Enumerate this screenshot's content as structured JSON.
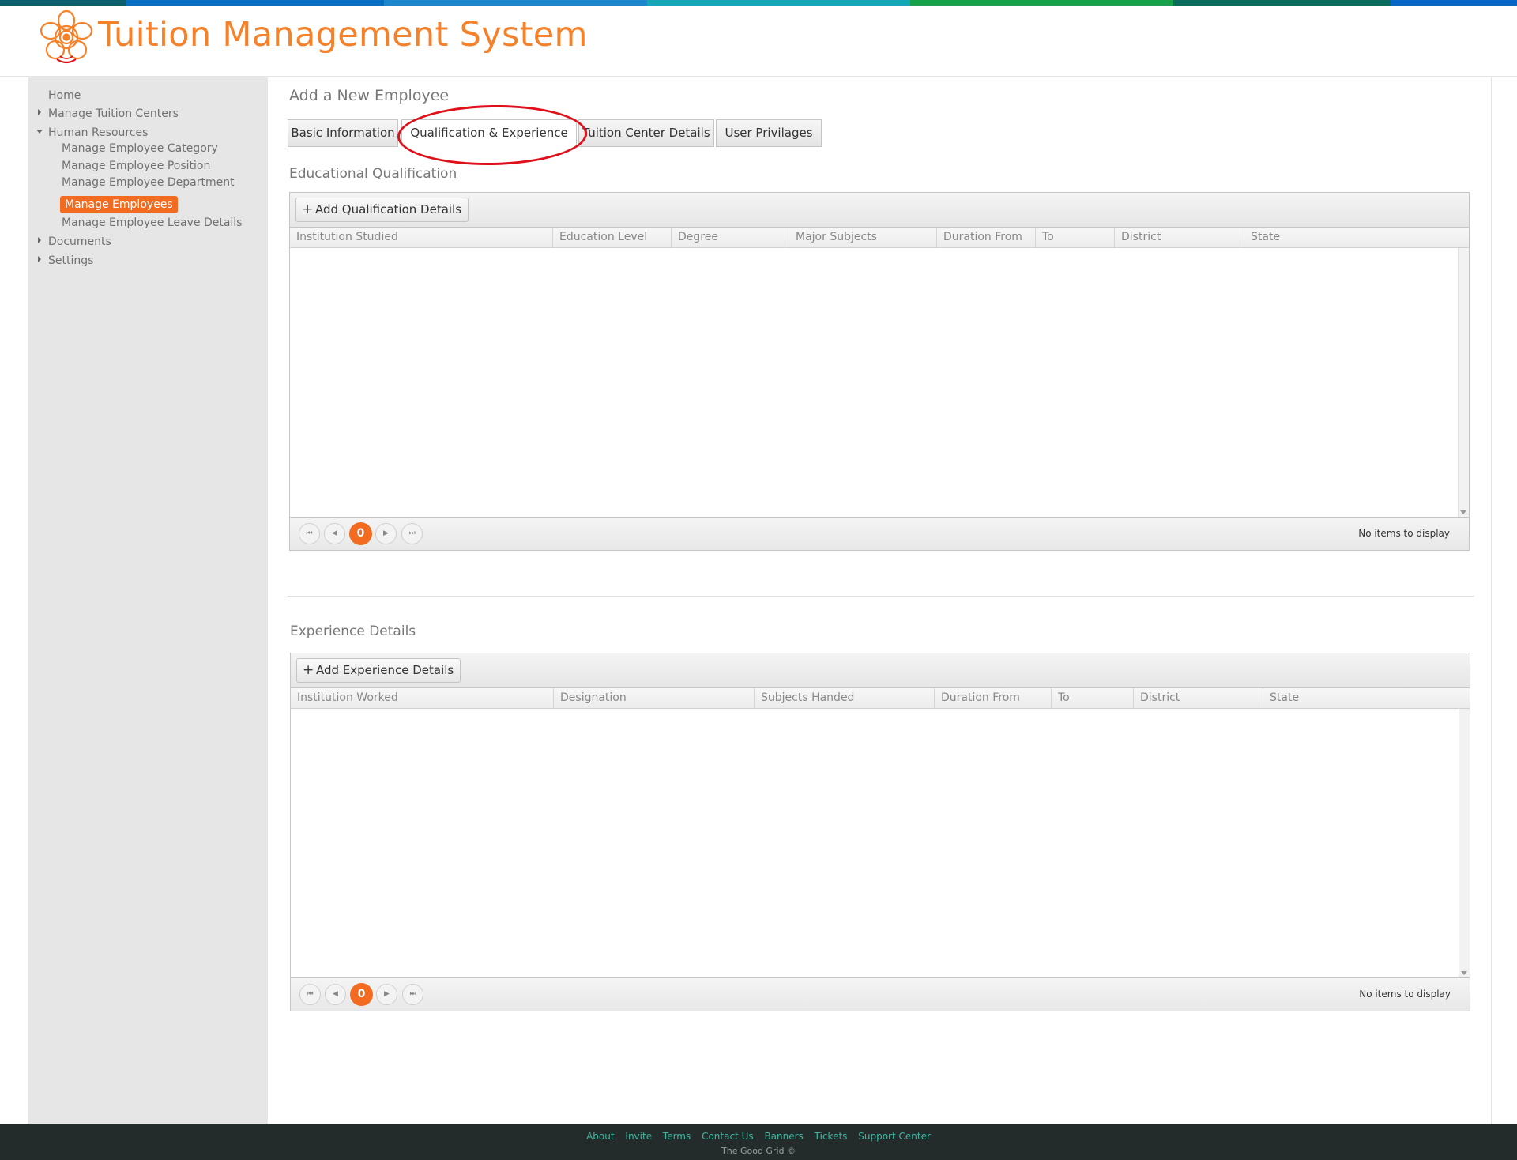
{
  "colors": {
    "strip": [
      "#0a5f6b",
      "#0b6ec0",
      "#1e86c9",
      "#17a6b8",
      "#1aa04a",
      "#0b6b5c",
      "#0a66c2"
    ],
    "accent": "#f26b21",
    "title": "#f5822b",
    "annotation": "#e0101a",
    "footer_bg": "#232b2b",
    "footer_link": "#3cb8a2"
  },
  "header": {
    "logo_icon": "lotus-logo-icon",
    "title": "Tuition Management System"
  },
  "sidebar": {
    "home": "Home",
    "manage_tuition_centers": "Manage Tuition Centers",
    "human_resources": "Human Resources",
    "hr_items": [
      "Manage Employee Category",
      "Manage Employee Position",
      "Manage Employee Department",
      "Manage Employees",
      "Manage Employee Leave Details"
    ],
    "documents": "Documents",
    "settings": "Settings"
  },
  "main": {
    "page_title": "Add a New Employee",
    "tabs": [
      {
        "label": "Basic Information"
      },
      {
        "label": "Qualification & Experience"
      },
      {
        "label": "Tuition Center Details"
      },
      {
        "label": "User Privilages"
      }
    ],
    "active_tab": "Qualification & Experience",
    "qualification": {
      "title": "Educational Qualification",
      "add_button": "Add Qualification Details",
      "columns": [
        "Institution Studied",
        "Education Level",
        "Degree",
        "Major Subjects",
        "Duration From",
        "To",
        "District",
        "State"
      ],
      "pager_page": "0",
      "empty_text": "No items to display"
    },
    "experience": {
      "title": "Experience Details",
      "add_button": "Add Experience Details",
      "columns": [
        "Institution Worked",
        "Designation",
        "Subjects Handed",
        "Duration From",
        "To",
        "District",
        "State"
      ],
      "pager_page": "0",
      "empty_text": "No items to display"
    },
    "pager_icons": {
      "first": "first-page-icon",
      "prev": "prev-page-icon",
      "next": "next-page-icon",
      "last": "last-page-icon"
    }
  },
  "footer": {
    "links": [
      "About",
      "Invite",
      "Terms",
      "Contact Us",
      "Banners",
      "Tickets",
      "Support Center"
    ],
    "copyright": "The Good Grid ©"
  }
}
